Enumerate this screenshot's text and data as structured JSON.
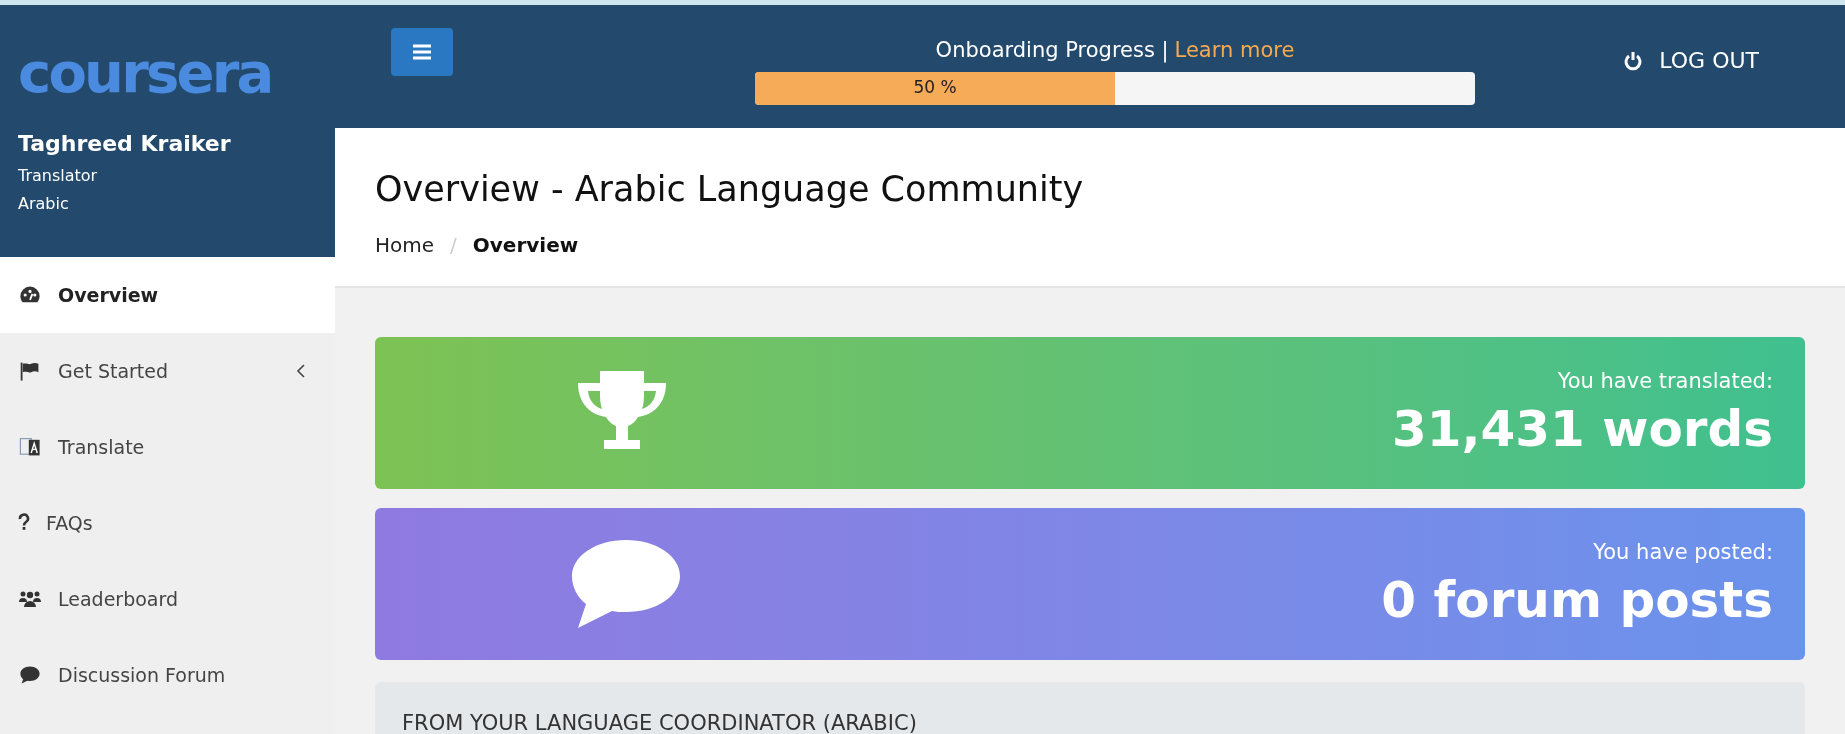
{
  "sidebar": {
    "logo": "coursera",
    "user": {
      "name": "Taghreed Kraiker",
      "role": "Translator",
      "language": "Arabic"
    },
    "items": [
      {
        "label": "Overview",
        "kind": "dashboard",
        "selected": true,
        "expandable": false
      },
      {
        "label": "Get Started",
        "kind": "flag",
        "selected": false,
        "expandable": true
      },
      {
        "label": "Translate",
        "kind": "translate",
        "selected": false,
        "expandable": false
      },
      {
        "label": "FAQs",
        "kind": "question",
        "selected": false,
        "expandable": false
      },
      {
        "label": "Leaderboard",
        "kind": "users",
        "selected": false,
        "expandable": false
      },
      {
        "label": "Discussion Forum",
        "kind": "comment",
        "selected": false,
        "expandable": false
      }
    ]
  },
  "topbar": {
    "progress_label": "Onboarding Progress |",
    "learn_more": "Learn more",
    "progress_text": "50 %",
    "level": 0.5,
    "logout": "LOG OUT"
  },
  "page": {
    "title": "Overview - Arabic Language Community",
    "breadcrumb_separator": "/",
    "breadcrumb": [
      {
        "label": "Home",
        "selected": false
      },
      {
        "label": "Overview",
        "selected": true
      }
    ]
  },
  "cards": [
    {
      "kind": "trophy",
      "caption": "You have translated:",
      "value": "31,431 words"
    },
    {
      "kind": "comment",
      "caption": "You have posted:",
      "value": "0 forum posts"
    }
  ],
  "coordinator_panel": {
    "title": "FROM YOUR LANGUAGE COORDINATOR (ARABIC)"
  }
}
